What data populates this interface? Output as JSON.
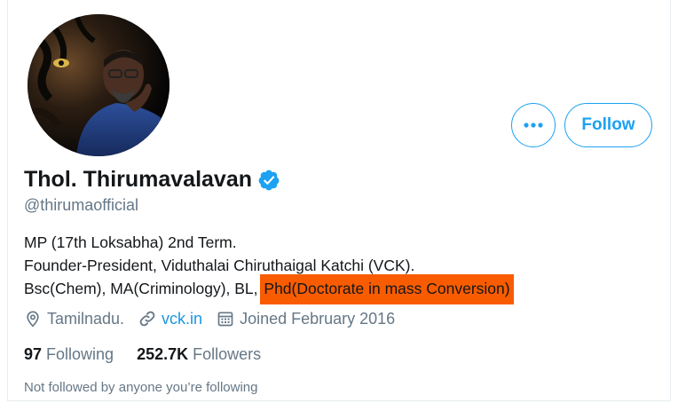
{
  "profile": {
    "display_name": "Thol. Thirumavalavan",
    "handle": "@thirumaofficial",
    "verified": true,
    "bio_lines": [
      "MP (17th Loksabha) 2nd Term.",
      "Founder-President, Viduthalai Chiruthaigal Katchi (VCK).",
      "Bsc(Chem), MA(Criminology), BL,"
    ],
    "bio_highlight": "Phd(Doctorate in mass Conversion)",
    "highlight_color": "#f95c00",
    "location": "Tamilnadu.",
    "website": "vck.in",
    "joined": "Joined February 2016",
    "following_count": "97",
    "following_label": "Following",
    "followers_count": "252.7K",
    "followers_label": "Followers",
    "not_followed_text": "Not followed by anyone you’re following"
  },
  "actions": {
    "more_label": "•••",
    "follow_label": "Follow"
  },
  "icons": {
    "more": "more-dots-icon",
    "verified": "verified-badge-icon",
    "location": "location-pin-icon",
    "website": "link-icon",
    "joined": "calendar-icon"
  },
  "colors": {
    "accent": "#1da1f2",
    "link": "#1b95e0",
    "secondary_text": "#657786",
    "primary_text": "#14171a"
  }
}
